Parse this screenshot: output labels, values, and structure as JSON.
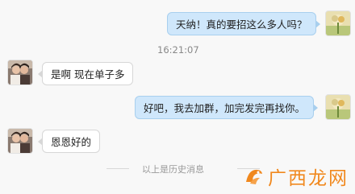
{
  "chat": {
    "messages": [
      {
        "side": "out",
        "text": "天纳！真的要招这么多人吗？"
      },
      {
        "side": "in",
        "text": "是啊 现在单子多"
      },
      {
        "side": "out",
        "text": "好吧，我去加群，加完发完再找你。"
      },
      {
        "side": "in",
        "text": "恩恩好的"
      }
    ],
    "timestamp": "16:21:07",
    "history_label": "以上是历史消息"
  },
  "watermark": {
    "text": "广西龙网"
  },
  "colors": {
    "outgoing_bubble": "#cfe7fb",
    "incoming_bubble": "#ffffff",
    "watermark": "#f0881e"
  },
  "icons": {
    "self_avatar": "flower-avatar-icon",
    "contact_avatar": "couple-photo-avatar-icon"
  }
}
